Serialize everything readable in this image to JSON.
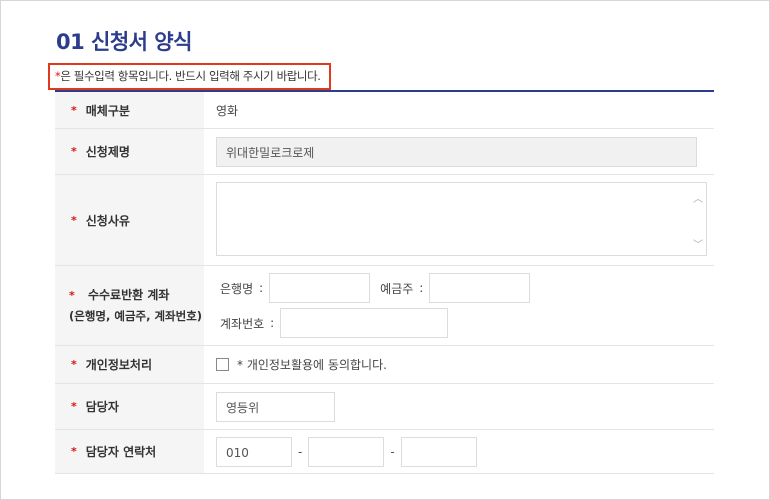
{
  "title": "01 신청서 양식",
  "notice": {
    "star": "*",
    "text": "은 필수입력 항목입니다. 반드시 입력해 주시기 바랍니다."
  },
  "required_mark": "*",
  "fields": {
    "media_type": {
      "label": "매체구분",
      "value": "영화"
    },
    "title": {
      "label": "신청제명",
      "value": "위대한밀로크로제"
    },
    "reason": {
      "label": "신청사유",
      "value": ""
    },
    "refund": {
      "label_line1": "수수료반환 계좌",
      "label_line2": "(은행명, 예금주, 계좌번호)",
      "bank_label": "은행명",
      "holder_label": "예금주",
      "account_label": "계좌번호",
      "colon": ":"
    },
    "privacy": {
      "label": "개인정보처리",
      "checkbox_text": "* 개인정보활용에 동의합니다."
    },
    "manager": {
      "label": "담당자",
      "value": "영등위"
    },
    "contact": {
      "label": "담당자 연락처",
      "phone1": "010",
      "phone2": "",
      "phone3": "",
      "sep": "-"
    }
  }
}
